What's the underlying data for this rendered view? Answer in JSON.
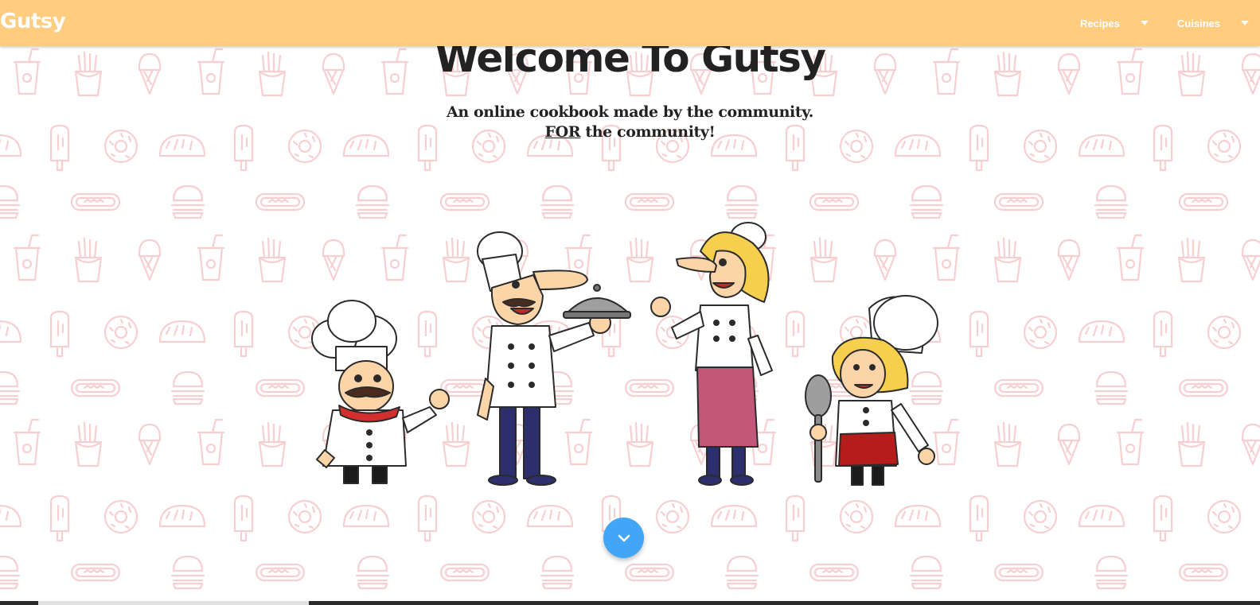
{
  "navbar": {
    "brand": "Gutsy",
    "items": [
      {
        "label": "Recipes"
      },
      {
        "label": "Cuisines"
      }
    ],
    "background": "#ffcc80"
  },
  "hero": {
    "title": "Welcome To Gutsy",
    "subtitle_line1": "An online cookbook made by the community.",
    "subtitle_emphasis": "FOR",
    "subtitle_line2_rest": " the community!"
  },
  "illustration": {
    "icon": "chefs-illustration"
  },
  "scroll_button": {
    "icon": "chevron-down-icon",
    "color": "#42a5f5"
  },
  "pattern": {
    "color": "#f8cfd0",
    "icons": [
      "soda-cup-icon",
      "fries-icon",
      "ice-cream-cone-icon",
      "taco-icon",
      "popsicle-icon",
      "donut-icon",
      "burger-icon",
      "hotdog-icon"
    ]
  }
}
